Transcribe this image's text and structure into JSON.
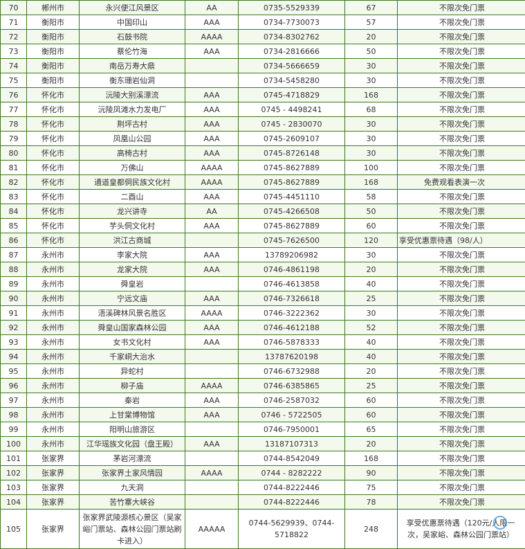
{
  "table": {
    "rows": [
      [
        "70",
        "郴州市",
        "永兴便江风景区",
        "AA",
        "0735-5529339",
        "67",
        "不限次免门票"
      ],
      [
        "71",
        "衡阳市",
        "中国印山",
        "AAA",
        "0734-7730073",
        "57",
        "不限次免门票"
      ],
      [
        "72",
        "衡阳市",
        "石鼓书院",
        "AAAA",
        "0734-8302762",
        "20",
        "不限次免门票"
      ],
      [
        "73",
        "衡阳市",
        "蔡伦竹海",
        "AAA",
        "0734-2816666",
        "50",
        "不限次免门票"
      ],
      [
        "74",
        "衡阳市",
        "南岳万寿大鼎",
        "",
        "0734-5666659",
        "30",
        "不限次免门票"
      ],
      [
        "75",
        "衡阳市",
        "衡东珊岩仙洞",
        "",
        "0734-5458280",
        "30",
        "不限次免门票"
      ],
      [
        "76",
        "怀化市",
        "沅陵大别溪漂流",
        "AAA",
        "0745-4718829",
        "168",
        "不限次免门票"
      ],
      [
        "77",
        "怀化市",
        "沅陵凤滩水力发电厂",
        "AAA",
        "0745 - 4498241",
        "68",
        "不限次免门票"
      ],
      [
        "78",
        "怀化市",
        "荆坪古村",
        "AAA",
        "0745 - 2830070",
        "30",
        "不限次免门票"
      ],
      [
        "79",
        "怀化市",
        "凤凰山公园",
        "AAA",
        "0745-2609107",
        "30",
        "不限次免门票"
      ],
      [
        "80",
        "怀化市",
        "高椅古村",
        "AAA",
        "0745-8726148",
        "30",
        "不限次免门票"
      ],
      [
        "81",
        "怀化市",
        "万佛山",
        "AAAA",
        "0745-8627889",
        "100",
        "不限次免门票"
      ],
      [
        "82",
        "怀化市",
        "通道皇都侗民族文化村",
        "AAAA",
        "0745-8627889",
        "168",
        "免费观看表演一次"
      ],
      [
        "83",
        "怀化市",
        "二酉山",
        "AAA",
        "0745-4451110",
        "58",
        "不限次免门票"
      ],
      [
        "84",
        "怀化市",
        "龙兴讲寺",
        "AA",
        "0745-4266508",
        "50",
        "不限次免门票"
      ],
      [
        "85",
        "怀化市",
        "芋头侗文化村",
        "AAA",
        "0745-8627889",
        "60",
        "不限次免门票"
      ],
      [
        "86",
        "怀化市",
        "洪江古商城",
        "",
        "0745-7626500",
        "120",
        "享受优惠票待遇（98/人）"
      ],
      [
        "87",
        "永州市",
        "李家大院",
        "AAA",
        "13789206982",
        "30",
        "不限次免门票"
      ],
      [
        "88",
        "永州市",
        "龙家大院",
        "AAA",
        "0746-4861198",
        "20",
        "不限次免门票"
      ],
      [
        "89",
        "永州市",
        "舜皇岩",
        "",
        "0746-4613858",
        "40",
        "不限次免门票"
      ],
      [
        "90",
        "永州市",
        "宁远文庙",
        "AAA",
        "0746-7326618",
        "25",
        "不限次免门票"
      ],
      [
        "91",
        "永州市",
        "浯溪碑林风景名胜区",
        "AAAA",
        "0746-3222362",
        "30",
        "不限次免门票"
      ],
      [
        "92",
        "永州市",
        "舜皇山国家森林公园",
        "AAA",
        "0746-4612188",
        "52",
        "不限次免门票"
      ],
      [
        "93",
        "永州市",
        "女书文化村",
        "AAA",
        "0746-5878333",
        "40",
        "不限次免门票"
      ],
      [
        "94",
        "永州市",
        "千家峒大治水",
        "",
        "13787620198",
        "40",
        "不限次免门票"
      ],
      [
        "95",
        "永州市",
        "异蛇村",
        "",
        "0746-6732988",
        "20",
        "不限次免门票"
      ],
      [
        "96",
        "永州市",
        "柳子庙",
        "AAAA",
        "0746-6385865",
        "25",
        "不限次免门票"
      ],
      [
        "97",
        "永州市",
        "秦岩",
        "AAA",
        "0746-2587032",
        "60",
        "不限次免门票"
      ],
      [
        "98",
        "永州市",
        "上甘棠博物馆",
        "AAA",
        "0746 - 5722505",
        "60",
        "不限次免门票"
      ],
      [
        "99",
        "永州市",
        "阳明山旅游区",
        "",
        "0746-7950001",
        "65",
        "不限次免门票"
      ],
      [
        "100",
        "永州市",
        "江华瑶族文化园（盘王殿）",
        "AAA",
        "13187107313",
        "20",
        "不限次免门票"
      ],
      [
        "101",
        "张家界",
        "茅岩河漂流",
        "",
        "0744-8542049",
        "168",
        "不限次免门票"
      ],
      [
        "102",
        "张家界",
        "张家界土家风情园",
        "AAAA",
        "0744 - 8282222",
        "90",
        "不限次免门票"
      ],
      [
        "103",
        "张家界",
        "九天洞",
        "",
        "0744-8222446",
        "75",
        "不限次免门票"
      ],
      [
        "104",
        "张家界",
        "苦竹寨大峡谷",
        "",
        "0744-8222446",
        "78",
        "不限次免门票"
      ],
      [
        "105",
        "张家界",
        "张家界武陵源核心景区（吴家峪门票站、森林公园门票站刷卡进入）",
        "AAAAA",
        "0744-5629939、0744-5718822",
        "248",
        "享受优惠票待遇（120元/人限一次，吴家峪、森林公园门票站）"
      ]
    ]
  }
}
